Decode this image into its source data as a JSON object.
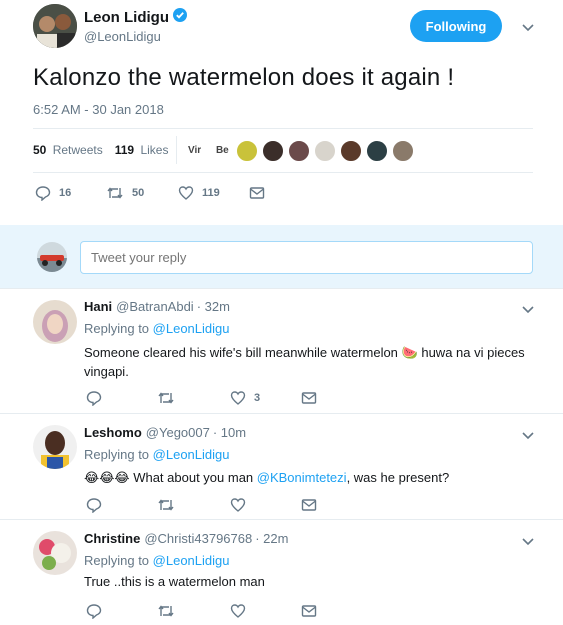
{
  "main_tweet": {
    "author_name": "Leon Lidigu",
    "author_handle": "@LeonLidigu",
    "follow_button": "Following",
    "text": "Kalonzo the watermelon does it again !",
    "timestamp": "6:52 AM - 30 Jan 2018",
    "retweets_count": "50",
    "retweets_label": "Retweets",
    "likes_count": "119",
    "likes_label": "Likes",
    "liker_names": [
      "Vir",
      "Be"
    ],
    "actions": {
      "replies": "16",
      "retweets": "50",
      "likes": "119"
    }
  },
  "reply_box": {
    "placeholder": "Tweet your reply"
  },
  "replies": [
    {
      "name": "Hani",
      "handle": "@BatranAbdi",
      "time": "· 32m",
      "replying_prefix": "Replying to",
      "replying_to": "@LeonLidigu",
      "text_before": "Someone cleared his wife's bill meanwhile watermelon",
      "emoji": "🍉",
      "text_after": " huwa na vi pieces vingapi.",
      "likes": "3"
    },
    {
      "name": "Leshomo",
      "handle": "@Yego007",
      "time": "· 10m",
      "replying_prefix": "Replying to",
      "replying_to": "@LeonLidigu",
      "emoji": "😂😂😂",
      "text_before": " What about you man ",
      "mention": "@KBonimtetezi",
      "text_after": ", was he present?",
      "likes": ""
    },
    {
      "name": "Christine",
      "handle": "@Christi43796768",
      "time": "· 22m",
      "replying_prefix": "Replying to",
      "replying_to": "@LeonLidigu",
      "text": "True ..this is a watermelon man",
      "likes": ""
    }
  ],
  "colors": {
    "accent": "#1da1f2",
    "muted": "#657786",
    "divider": "#e6ecf0",
    "watermelon": "#e0245e"
  }
}
